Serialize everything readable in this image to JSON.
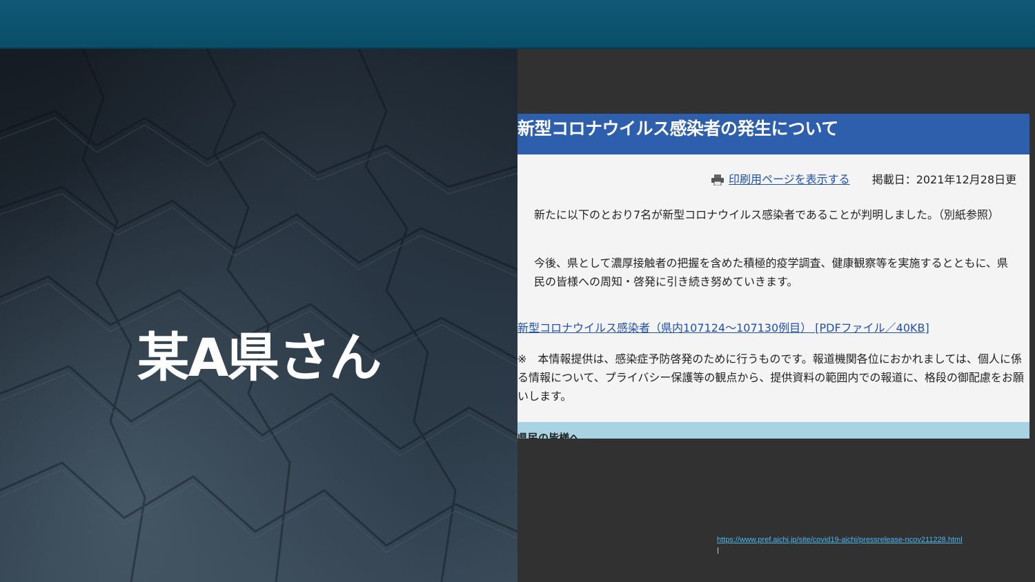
{
  "slide": {
    "title": "某A県さん"
  },
  "screenshot": {
    "header": "新型コロナウイルス感染者の発生について",
    "print_link": "印刷用ページを表示する",
    "post_date": "掲載日：2021年12月28日更",
    "paragraph1": "新たに以下のとおり7名が新型コロナウイルス感染者であることが判明しました。（別紙参照）",
    "paragraph2": "今後、県として濃厚接触者の把握を含めた積極的疫学調査、健康観察等を実施するとともに、県民の皆様への周知・啓発に引き続き努めていきます。",
    "pdf_link": "新型コロナウイルス感染者（県内107124～107130例目） [PDFファイル／40KB]",
    "note": "※　本情報提供は、感染症予防啓発のために行うものです。報道機関各位におかれましては、個人に係る情報について、プライバシー保護等の観点から、提供資料の範囲内での報道に、格段の御配慮をお願いします。",
    "band_text": "県民の皆様へ"
  },
  "source": {
    "url": "https://www.pref.aichi.jp/site/covid19-aichi/pressrelease-ncov211228.html"
  },
  "colors": {
    "top_bar": "#0a4d68",
    "header_blue": "#2d5fad",
    "link_blue": "#1f4fb0",
    "band_blue": "#a9d3e3",
    "url_cyan": "#4fb8f0"
  },
  "icons": {
    "printer": "printer-icon"
  }
}
